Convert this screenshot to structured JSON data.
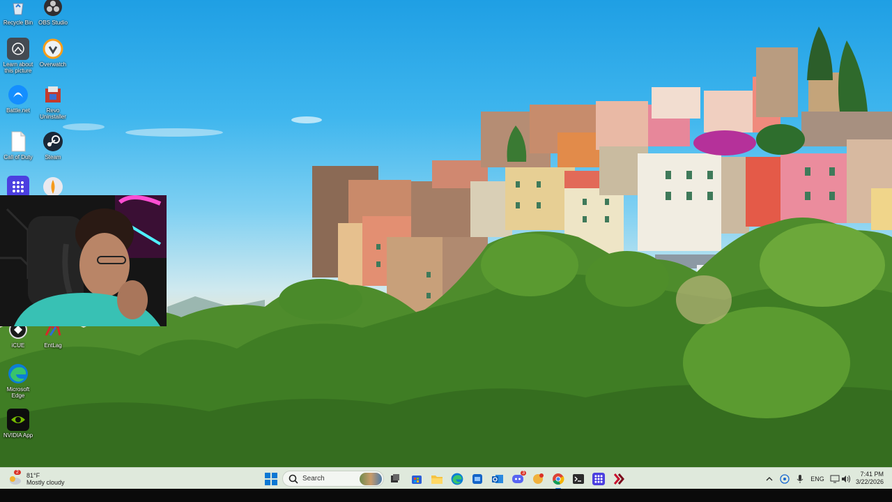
{
  "desktop": {
    "icons": [
      {
        "label": "Recycle Bin",
        "icon": "recycle-bin-icon"
      },
      {
        "label": "OBS Studio",
        "icon": "obs-icon"
      },
      {
        "label": "Learn about this picture",
        "icon": "camera-icon"
      },
      {
        "label": "Overwatch",
        "icon": "overwatch-icon"
      },
      {
        "label": "Battle.net",
        "icon": "battlenet-icon"
      },
      {
        "label": "Revo Uninstaller",
        "icon": "revo-uninstaller-icon"
      },
      {
        "label": "Call of Duty",
        "icon": "document-icon"
      },
      {
        "label": "Steam",
        "icon": "steam-icon"
      },
      {
        "label": "",
        "icon": "app-grid-icon"
      },
      {
        "label": "",
        "icon": "app-icon"
      },
      {
        "label": "iCUE",
        "icon": "icue-icon"
      },
      {
        "label": "EntLag",
        "icon": "entlag-icon"
      },
      {
        "label": "Microsoft Edge",
        "icon": "edge-icon"
      },
      {
        "label": "NVIDIA App",
        "icon": "nvidia-icon"
      }
    ]
  },
  "taskbar": {
    "weather": {
      "temp": "81°F",
      "condition": "Mostly cloudy",
      "badge": "2"
    },
    "search": {
      "placeholder": "Search"
    },
    "apps": [
      "start-icon",
      "search-icon",
      "widget-icon",
      "task-view-icon",
      "store-icon",
      "file-explorer-icon",
      "edge-icon",
      "app-icon",
      "outlook-icon",
      "discord-icon",
      "app-icon",
      "chrome-icon",
      "terminal-icon",
      "app-icon",
      "app-icon"
    ],
    "discord_badge": "3",
    "tray": {
      "language": "ENG"
    },
    "clock": {
      "time": "7:41 PM",
      "date": "3/22/2026"
    }
  },
  "colors": {
    "taskbar_bg": "#dfe9dc",
    "accent": "#1a73e8"
  }
}
